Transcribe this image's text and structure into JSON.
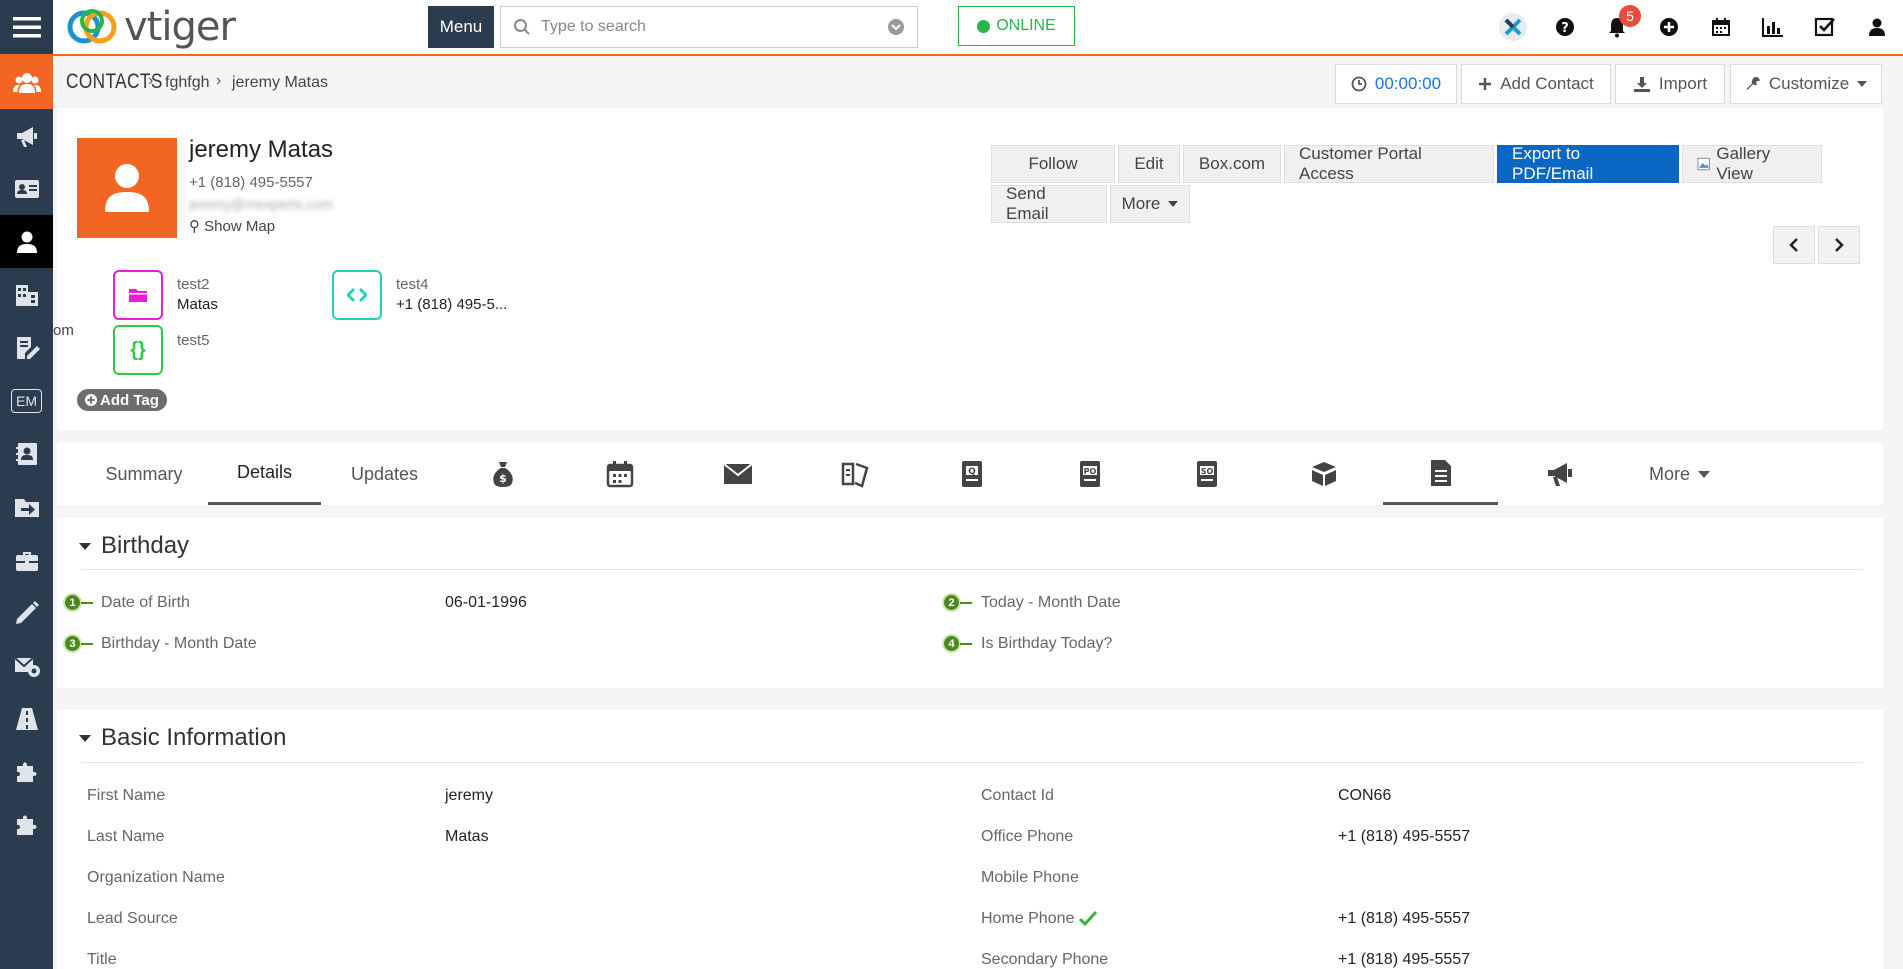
{
  "app": {
    "logo_text": "vtiger",
    "menu_label": "Menu"
  },
  "search": {
    "placeholder": "Type to search"
  },
  "status": {
    "online_label": "ONLINE",
    "online_color": "#2ab54a"
  },
  "notifications": {
    "count": "5"
  },
  "colors": {
    "accent": "#f26522",
    "sidebar": "#2b3c4e",
    "primary": "#0b67c4"
  },
  "sidebar": {
    "em_label": "EM"
  },
  "breadcrumb": {
    "module": "CONTACTS",
    "parent": "fghfgh",
    "current": "jeremy Matas"
  },
  "header_actions": {
    "timer": "00:00:00",
    "add_contact": "Add Contact",
    "import": "Import",
    "customize": "Customize"
  },
  "record": {
    "name": "jeremy Matas",
    "phone": "+1 (818) 495-5557",
    "email": "jeremy@mexperts.com",
    "show_map": "Show Map"
  },
  "actions": {
    "follow": "Follow",
    "edit": "Edit",
    "box": "Box.com",
    "portal": "Customer Portal Access",
    "export": "Export to PDF/Email",
    "gallery": "Gallery View",
    "send_email": "Send Email",
    "more": "More"
  },
  "tags": [
    {
      "label": "test2",
      "value": "Matas",
      "color": "#e91edb"
    },
    {
      "label": "test4",
      "value": "+1 (818) 495-5...",
      "color": "#1fd1b5"
    },
    {
      "label": "test5",
      "value": "",
      "color": "#2ecc40"
    }
  ],
  "add_tag": "Add Tag",
  "side_stub": "om",
  "tabs": {
    "summary": "Summary",
    "details": "Details",
    "updates": "Updates",
    "more": "More"
  },
  "birthday": {
    "title": "Birthday",
    "fields": [
      {
        "num": "1",
        "label": "Date of Birth",
        "value": "06-01-1996"
      },
      {
        "num": "2",
        "label": "Today - Month Date",
        "value": ""
      },
      {
        "num": "3",
        "label": "Birthday - Month Date",
        "value": ""
      },
      {
        "num": "4",
        "label": "Is Birthday Today?",
        "value": ""
      }
    ]
  },
  "basic": {
    "title": "Basic Information",
    "left": [
      {
        "label": "First Name",
        "value": "jeremy"
      },
      {
        "label": "Last Name",
        "value": "Matas"
      },
      {
        "label": "Organization Name",
        "value": ""
      },
      {
        "label": "Lead Source",
        "value": ""
      },
      {
        "label": "Title",
        "value": ""
      }
    ],
    "right": [
      {
        "label": "Contact Id",
        "value": "CON66"
      },
      {
        "label": "Office Phone",
        "value": "+1 (818) 495-5557"
      },
      {
        "label": "Mobile Phone",
        "value": ""
      },
      {
        "label": "Home Phone",
        "value": "+1 (818) 495-5557"
      },
      {
        "label": "Secondary Phone",
        "value": "+1 (818) 495-5557"
      }
    ]
  }
}
